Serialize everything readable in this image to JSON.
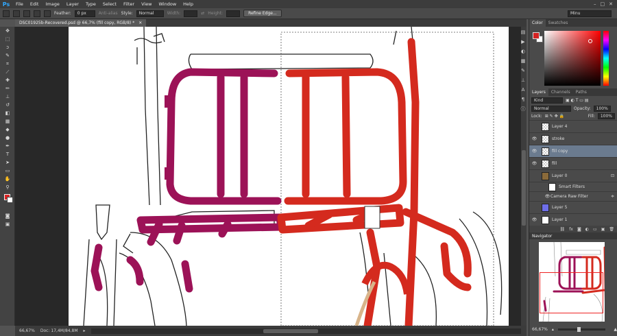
{
  "app": {
    "logo": "Ps"
  },
  "menu": [
    "File",
    "Edit",
    "Image",
    "Layer",
    "Type",
    "Select",
    "Filter",
    "View",
    "Window",
    "Help"
  ],
  "window_controls": [
    "–",
    "□",
    "✕"
  ],
  "options": {
    "feather_label": "Feather:",
    "feather_value": "0 px",
    "antialias_label": "Anti-alias",
    "style_label": "Style:",
    "style_value": "Normal",
    "width_label": "Width:",
    "height_label": "Height:",
    "refine_label": "Refine Edge...",
    "workspace_value": "Minu"
  },
  "document": {
    "tab_title": "DSC01925b-Recovered.psd @ 66,7% (fill copy, RGB/8) *",
    "tab_close": "✕"
  },
  "status": {
    "zoom": "66,67%",
    "doc_size": "Doc: 17,4M/84,8M"
  },
  "colors": {
    "foreground": "#d42222",
    "background": "#ffffff",
    "left_fill": "#9c1257",
    "right_fill": "#d42a1e"
  },
  "color_panel": {
    "tabs": [
      "Color",
      "Swatches"
    ]
  },
  "layers_panel": {
    "tabs": [
      "Layers",
      "Channels",
      "Paths"
    ],
    "kind_value": "Kind",
    "blend_value": "Normal",
    "opacity_label": "Opacity:",
    "opacity_value": "100%",
    "lock_label": "Lock:",
    "fill_label": "Fill:",
    "fill_value": "100%",
    "layers": [
      {
        "name": "Layer 4",
        "visible": false
      },
      {
        "name": "stroke",
        "visible": true
      },
      {
        "name": "fill copy",
        "visible": true,
        "selected": true
      },
      {
        "name": "fill",
        "visible": true
      },
      {
        "name": "Layer 0",
        "visible": false
      },
      {
        "name": "Smart Filters",
        "visible": false
      },
      {
        "name": "Camera Raw Filter",
        "visible": true
      },
      {
        "name": "Layer 5",
        "visible": false
      },
      {
        "name": "Layer 1",
        "visible": true
      }
    ]
  },
  "navigator": {
    "title": "Navigator",
    "zoom": "66,67%"
  }
}
